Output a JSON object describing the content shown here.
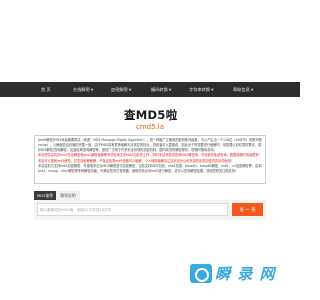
{
  "nav": {
    "items": [
      {
        "label": "首 页",
        "caret": false
      },
      {
        "label": "在线解密",
        "caret": true
      },
      {
        "label": "加密解密",
        "caret": true
      },
      {
        "label": "编码转换",
        "caret": true
      },
      {
        "label": "字符串转换",
        "caret": true
      },
      {
        "label": "帮助信息",
        "caret": true
      }
    ]
  },
  "logo": {
    "title_cn": "查MD5啦",
    "title_en": "cmd5.la"
  },
  "intro": {
    "lines": [
      {
        "text": "[md5解密]MD5消息摘要算法（英语：MD5 Message-Digest Algorithm），是一种被广泛使用的密码散列函数，可以产生出一个128位（16字节）的散列值（hash",
        "red": false
      },
      {
        "text": "value），以确保信息传输的完整一致。由于MD5具有很多破解无法恢复的特点，查看者可以直接看，因此对于所需要进行破解时，常需要以彩虹表的算法，或者",
        "red": false
      },
      {
        "text": "[MD5解密]查询解密，加盐哈希查询解密等，提供广泛用于许多安全领域的加密机制，国内成熟的解密服务，您随时随地查询。",
        "red": false
      },
      {
        "text": "本站提供高效的md5在线解密和sha1解密破解等专项查询生成MD5加密的工作，同时本站也提供查询MD5解密值，不收费的免费查询，数据库随时持续更新！",
        "red": true
      },
      {
        "text": "本站可以接受md5解密，并支持破解破解，不保证各类md5值都可以破解，个人使用破解请注意本站对公司来源的各类加密内容请勿使用！",
        "red": true
      },
      {
        "text": "本站目前已支持md5加密解密，可使用多达对MD5解密进行加密解密，当前支持MD5加密，sha1加密，base64，base64解密，md4，url加密解密等，由本站精选",
        "red": false
      },
      {
        "text": "md4，mysql，ntlm解密等多种解密功能，可满足您的日常需要。使用前务必对md5进行解密，并可以查到解密结果，感谢您的关注和支持！",
        "red": false
      }
    ]
  },
  "tabs": {
    "active": "MD5加密",
    "inactive": "解密说明"
  },
  "search": {
    "placeholder": "输入要解密的MD5值，例如32字符或16字符",
    "value": "",
    "button_label": "查 一 查"
  },
  "watermark": {
    "text": "瞬 录 网"
  },
  "colors": {
    "accent": "#f25a1c",
    "nav_bg": "#2d2d2d",
    "watermark": "#39a9de",
    "warning_text": "#e02020"
  }
}
